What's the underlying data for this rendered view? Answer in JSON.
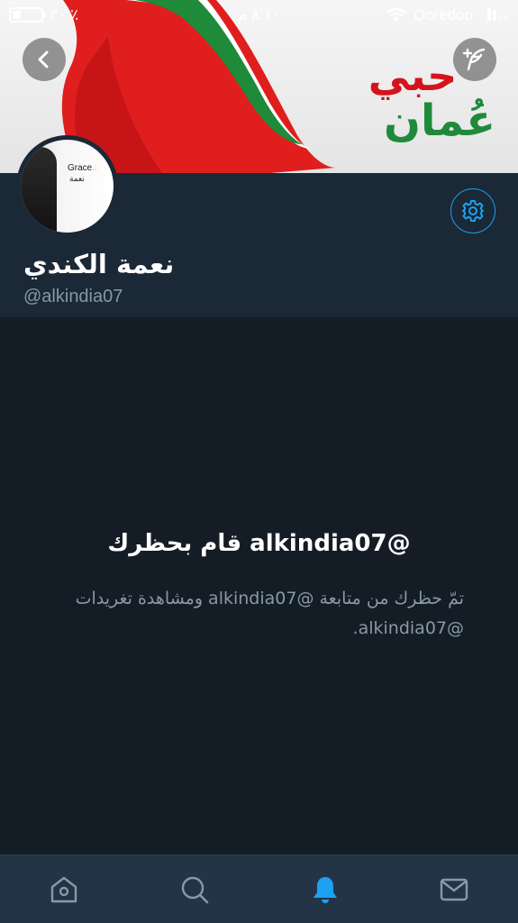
{
  "status_bar": {
    "battery_percent": "٣٠ ٪",
    "battery_level": 0.3,
    "time": "٨:١٠ م",
    "carrier": "Ooredoo"
  },
  "banner": {
    "text_top": "حبي",
    "text_bottom": "عُمان"
  },
  "avatar": {
    "word_en": "Grace",
    "word_ar": "نعمة"
  },
  "profile": {
    "display_name": "نعمة الكندي",
    "handle": "@alkindia07"
  },
  "blocked": {
    "title": "@alkindia07 قام بحظرك",
    "description": "تمّ حظرك من متابعة @alkindia07 ومشاهدة تغريدات @alkindia07."
  },
  "colors": {
    "accent": "#1da1f2",
    "background": "#141d26",
    "header": "#1b2836",
    "tabbar": "#243447",
    "muted_text": "#8899a6"
  },
  "icons": {
    "back": "chevron-left-icon",
    "compose": "feather-plus-icon",
    "settings": "gear-icon",
    "home": "home-icon",
    "search": "search-icon",
    "notifications": "bell-icon",
    "messages": "envelope-icon"
  },
  "tabbar": {
    "active_tab": "notifications"
  }
}
